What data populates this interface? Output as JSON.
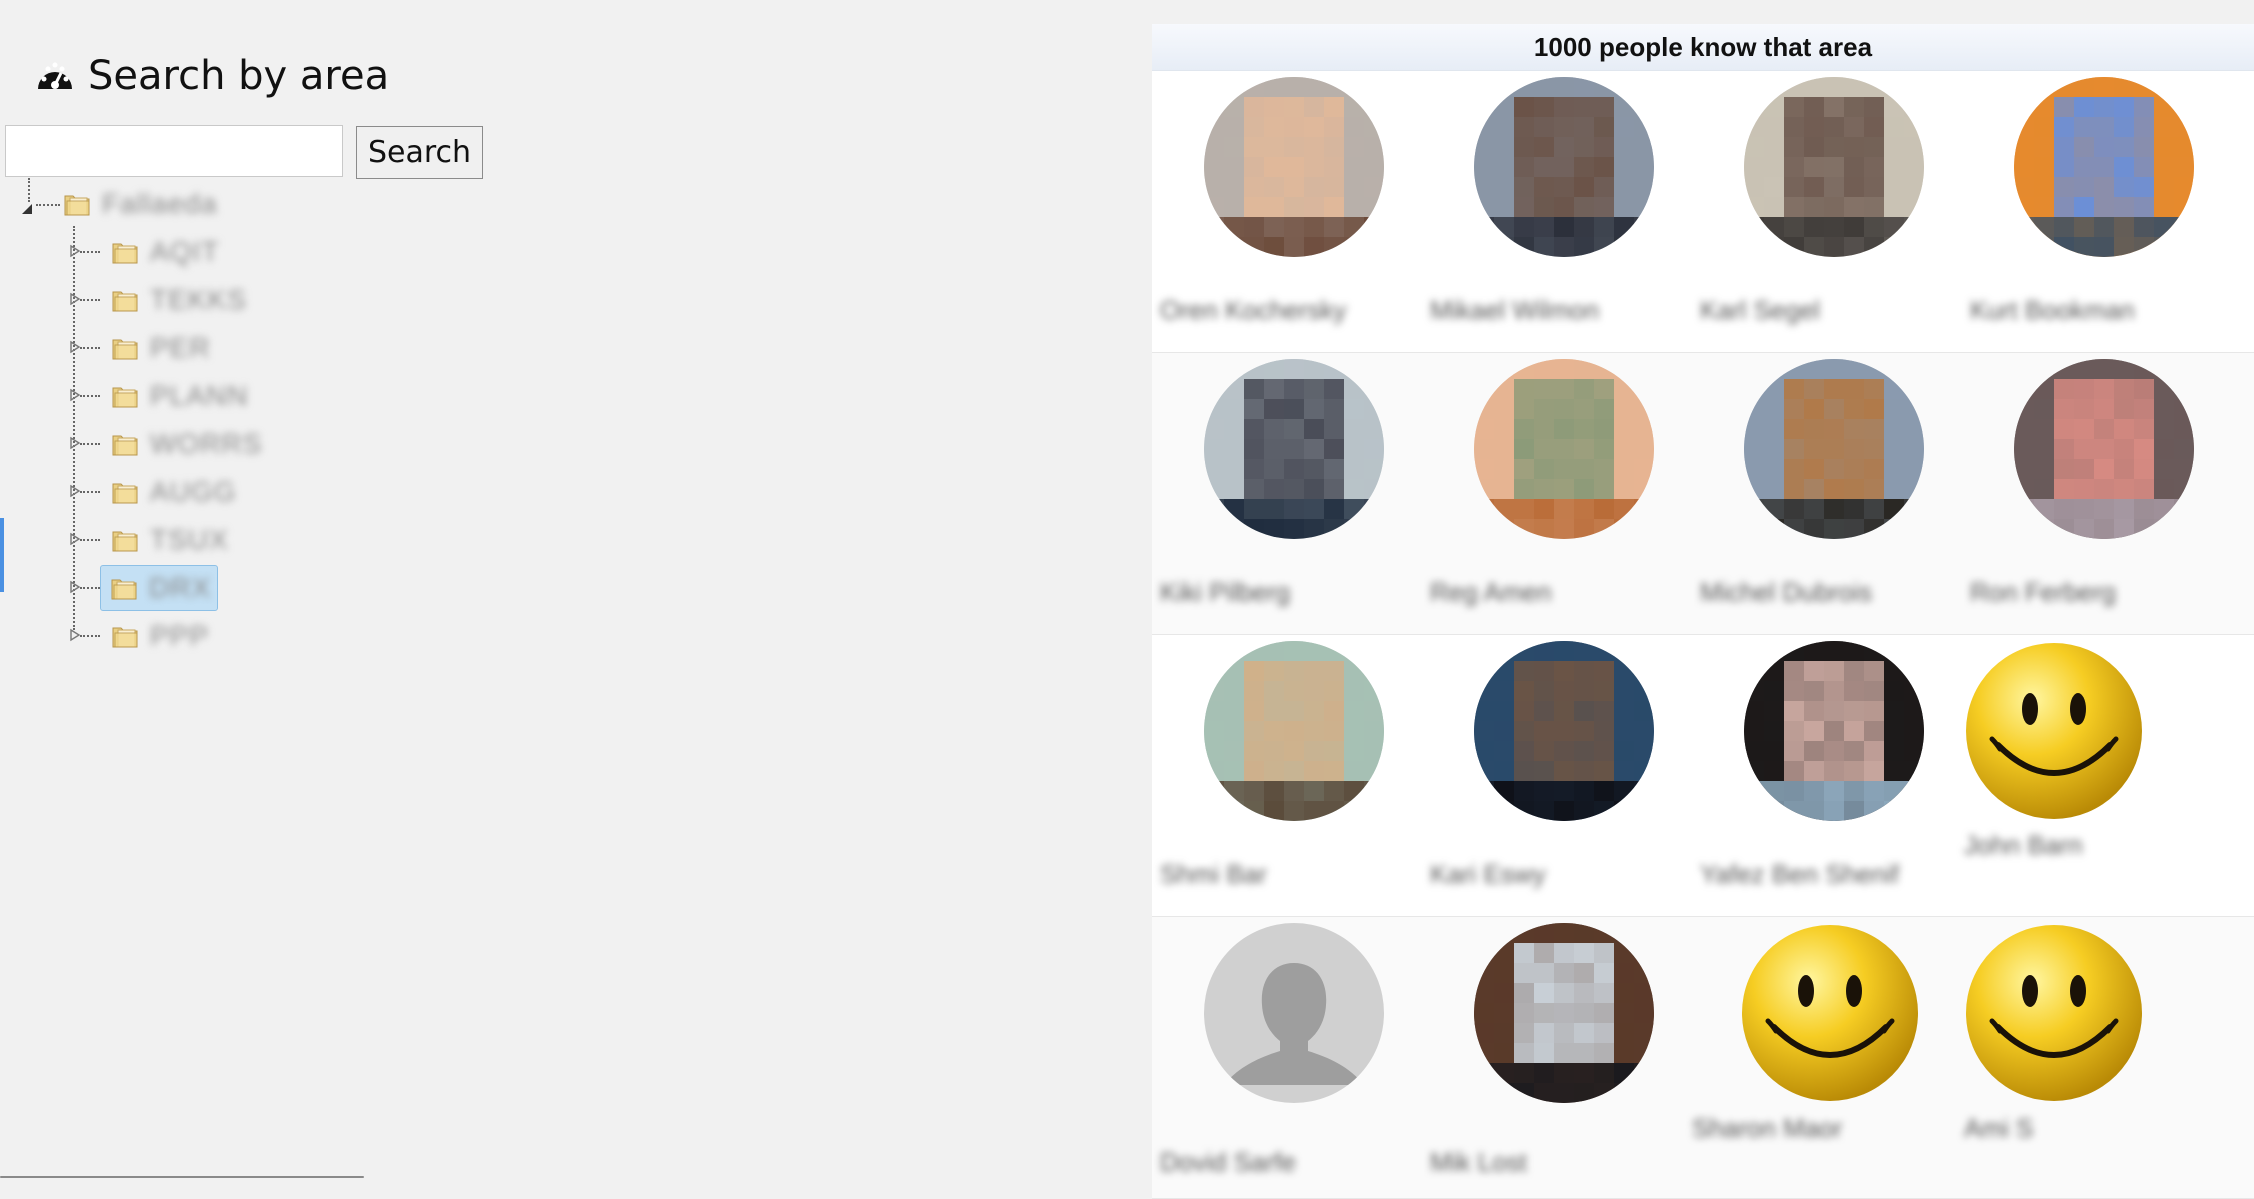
{
  "title": "Search by area",
  "search": {
    "value": "",
    "placeholder": "",
    "button_label": "Search"
  },
  "tree": {
    "root": {
      "label": "Fallaeda",
      "expanded": true
    },
    "children": [
      {
        "label": "AQIT"
      },
      {
        "label": "TEKKS"
      },
      {
        "label": "PER"
      },
      {
        "label": "PLANN"
      },
      {
        "label": "WORRS"
      },
      {
        "label": "AUGG"
      },
      {
        "label": "TSUX"
      },
      {
        "label": "DRX",
        "selected": true
      },
      {
        "label": "PPP"
      }
    ]
  },
  "results": {
    "header": "1000 people know that area",
    "people": [
      {
        "name": "Oren Kochersky",
        "avatar": "photo",
        "palette": [
          "#6b4a3a",
          "#e0b89a",
          "#b8b0aa"
        ]
      },
      {
        "name": "Mikael Wilmon",
        "avatar": "photo",
        "palette": [
          "#2b2f3a",
          "#6a5246",
          "#8a96a6"
        ]
      },
      {
        "name": "Karl Segel",
        "avatar": "photo",
        "palette": [
          "#3a3634",
          "#6e5a50",
          "#c9c2b4"
        ]
      },
      {
        "name": "Kurt Bookman",
        "avatar": "photo",
        "palette": [
          "#3b4f64",
          "#6c8fd6",
          "#e58a2e"
        ]
      },
      {
        "name": "Kiki Pilberg",
        "avatar": "photo",
        "palette": [
          "#1e2b3d",
          "#4a4d58",
          "#b8c2c8"
        ]
      },
      {
        "name": "Reg Amen",
        "avatar": "photo",
        "palette": [
          "#b86a36",
          "#8a9a78",
          "#e6b492"
        ]
      },
      {
        "name": "Michel Dubrois",
        "avatar": "photo",
        "palette": [
          "#2a2824",
          "#b07a4a",
          "#8a9aae"
        ]
      },
      {
        "name": "Ron Ferberg",
        "avatar": "photo",
        "palette": [
          "#a89aa4",
          "#d68a82",
          "#6a5a5a"
        ]
      },
      {
        "name": "Shmi Bar",
        "avatar": "photo",
        "palette": [
          "#5a4a3a",
          "#d0b08a",
          "#a6c0b4"
        ]
      },
      {
        "name": "Kari Eswy",
        "avatar": "photo",
        "palette": [
          "#0e0e14",
          "#6a5446",
          "#2a4a6a"
        ]
      },
      {
        "name": "Yafez Ben Shenif",
        "avatar": "photo",
        "palette": [
          "#8eaabf",
          "#caa8a0",
          "#1d1a1a"
        ]
      },
      {
        "name": "John Barn",
        "avatar": "smiley"
      },
      {
        "name": "Dovid Sarfe",
        "avatar": "default"
      },
      {
        "name": "Mik Lost",
        "avatar": "photo",
        "palette": [
          "#1a1a1e",
          "#c8cfd6",
          "#5a3a2a"
        ]
      },
      {
        "name": "Sharon Maor",
        "avatar": "smiley"
      },
      {
        "name": "Ami S",
        "avatar": "smiley"
      }
    ]
  }
}
